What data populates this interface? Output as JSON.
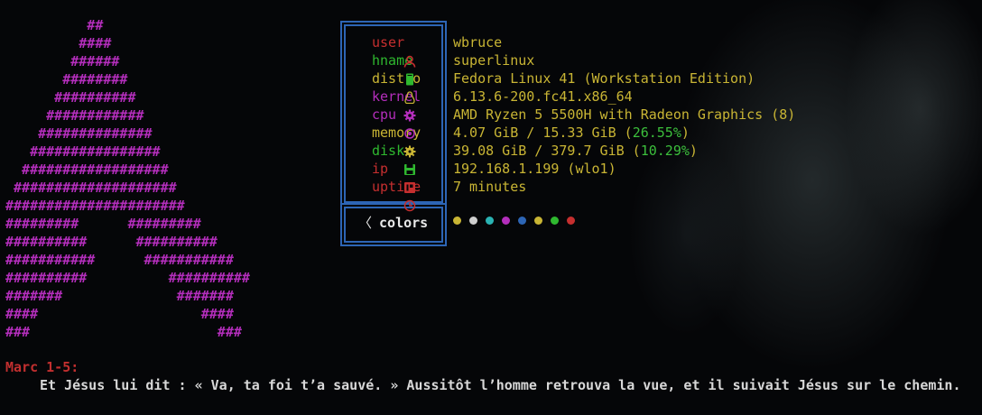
{
  "ascii_logo": "          ##\n         ####\n        ######\n       ########\n      ##########\n     ############\n    ##############\n   ################\n  ##################\n ####################\n######################\n#########      #########\n##########      ##########\n###########      ###########\n##########          ##########\n#######              #######\n####                    ####\n###                       ###",
  "labels": [
    {
      "icon": "user-icon",
      "text": "user",
      "color": "#c62f2f"
    },
    {
      "icon": "phone-icon",
      "text": "hname",
      "color": "#2fb82f"
    },
    {
      "icon": "penguin-icon",
      "text": "distro",
      "color": "#c9b534"
    },
    {
      "icon": "gear-icon",
      "text": "kernel",
      "color": "#b42ebc"
    },
    {
      "icon": "cpu-icon",
      "text": "cpu",
      "color": "#b42ebc"
    },
    {
      "icon": "memory-icon",
      "text": "memory",
      "color": "#c9b534"
    },
    {
      "icon": "disk-icon",
      "text": "disk",
      "color": "#2fb82f"
    },
    {
      "icon": "ip-icon",
      "text": "ip",
      "color": "#c62f2f"
    },
    {
      "icon": "clock-icon",
      "text": "uptime",
      "color": "#c62f2f"
    }
  ],
  "values": {
    "user": "wbruce",
    "hname": "superlinux",
    "distro": "Fedora Linux 41 (Workstation Edition)",
    "kernel": "6.13.6-200.fc41.x86_64",
    "cpu": "AMD Ryzen 5 5500H with Radeon Graphics (8)",
    "memory_main": "4.07 GiB / 15.33 GiB (",
    "memory_pct": "26.55%",
    "memory_close": ")",
    "disk_main": "39.08 GiB / 379.7 GiB (",
    "disk_pct": "10.29%",
    "disk_close": ")",
    "ip": "192.168.1.199 (wlo1)",
    "uptime": "7 minutes"
  },
  "colors_row": {
    "arrow": "〈",
    "label": "colors"
  },
  "palette": [
    "#c9b534",
    "#cfcfcf",
    "#2ab3b3",
    "#b42ebc",
    "#2d65b5",
    "#c9b534",
    "#2fb82f",
    "#c62f2f"
  ],
  "verse": {
    "reference": "Marc 1-5:",
    "text": "Et Jésus lui dit : « Va, ta foi t’a sauvé. » Aussitôt l’homme retrouva la vue, et il suivait Jésus sur le chemin."
  }
}
